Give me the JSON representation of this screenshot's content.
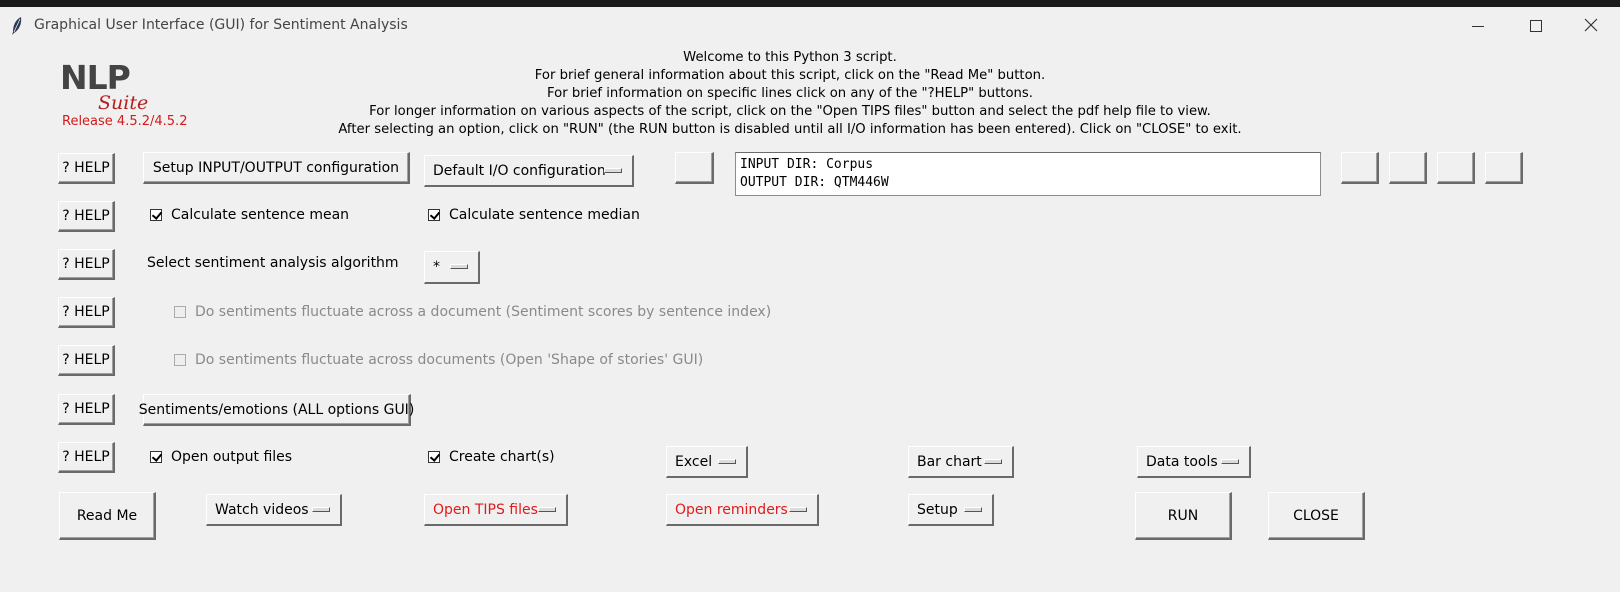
{
  "window": {
    "title": "Graphical User Interface (GUI) for Sentiment Analysis",
    "icon": "feather-icon"
  },
  "logo": {
    "nlp": "NLP",
    "suite": "Suite",
    "release": "Release 4.5.2/4.5.2"
  },
  "welcome": {
    "line1": "Welcome to this Python 3 script.",
    "line2": "For brief general information about this script, click on the \"Read Me\" button.",
    "line3": "For brief information on specific lines click on any of the \"?HELP\" buttons.",
    "line4": "For longer information on various aspects of the script, click on the \"Open TIPS files\" button and select the pdf help file to view.",
    "line5": "After selecting an option, click on \"RUN\" (the RUN button is disabled until all I/O information has been entered).   Click on \"CLOSE\" to exit."
  },
  "help_label": "? HELP",
  "io": {
    "setup_button": "Setup INPUT/OUTPUT configuration",
    "config_menu": "Default I/O configuration",
    "input_line": "INPUT DIR: Corpus",
    "output_line": "OUTPUT DIR: QTM446W"
  },
  "options": {
    "sentence_mean": "Calculate sentence mean",
    "sentence_median": "Calculate sentence median",
    "algorithm_label": "Select sentiment analysis algorithm",
    "algorithm_value": "*",
    "fluctuate_document": "Do sentiments fluctuate across a document (Sentiment scores by sentence index)",
    "fluctuate_documents": "Do sentiments fluctuate across documents (Open 'Shape of stories' GUI)",
    "all_options_button": "Sentiments/emotions (ALL options GUI)",
    "open_output_files": "Open output files",
    "create_charts": "Create chart(s)",
    "chart_package": "Excel",
    "chart_type": "Bar chart",
    "data_tools": "Data tools"
  },
  "bottom": {
    "read_me": "Read Me",
    "watch_videos": "Watch videos",
    "open_tips": "Open TIPS files",
    "open_reminders": "Open reminders",
    "setup": "Setup",
    "run": "RUN",
    "close": "CLOSE"
  },
  "colors": {
    "background": "#f0f0f0",
    "accent_red": "#e01b1b",
    "logo_red": "#b41e1e"
  }
}
